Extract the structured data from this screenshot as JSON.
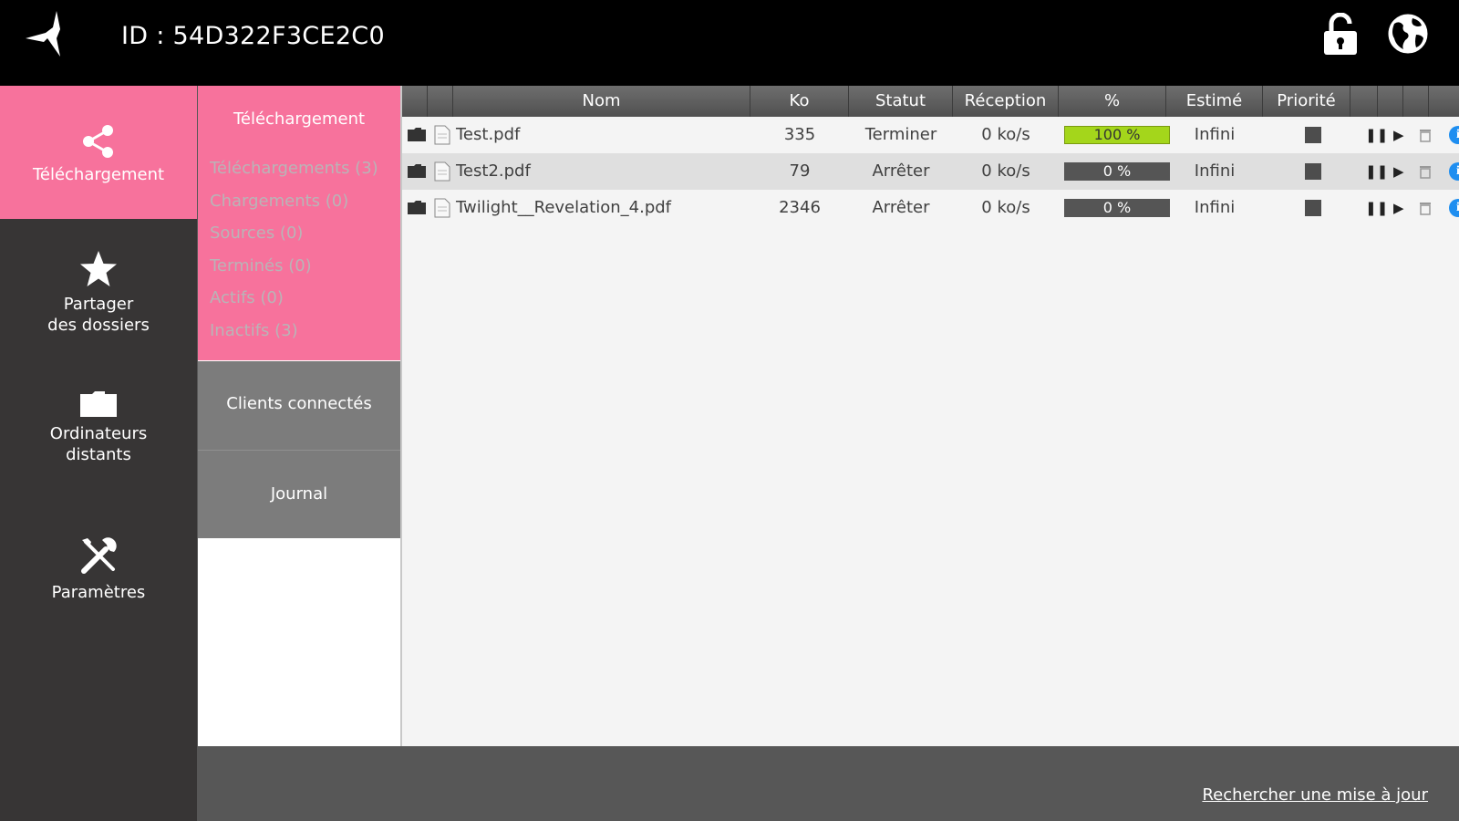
{
  "header": {
    "device_id": "ID : 54D322F3CE2C0",
    "icons": {
      "logo": "bird-logo",
      "lock": "unlocked-padlock-icon",
      "globe": "globe-icon"
    }
  },
  "sidebar": {
    "items": [
      {
        "label": "Téléchargement",
        "icon": "share-icon",
        "active": true
      },
      {
        "label": "Partager\ndes dossiers",
        "icon": "star-icon",
        "active": false
      },
      {
        "label": "Ordinateurs\ndistants",
        "icon": "folder-icon",
        "active": false
      },
      {
        "label": "Paramètres",
        "icon": "tools-icon",
        "active": false
      }
    ]
  },
  "submenu": {
    "title": "Téléchargement",
    "filters": [
      "Téléchargements (3)",
      "Chargements (0)",
      "Sources (0)",
      "Terminés (0)",
      "Actifs (0)",
      "Inactifs (3)"
    ],
    "clients_label": "Clients connectés",
    "journal_label": "Journal"
  },
  "table": {
    "columns": [
      "Nom",
      "Ko",
      "Statut",
      "Réception",
      "%",
      "Estimé",
      "Priorité"
    ],
    "rows": [
      {
        "name": "Test.pdf",
        "size_ko": "335",
        "status": "Terminer",
        "reception": "0 ko/s",
        "percent_label": "100 %",
        "progress": 1.0,
        "estimate": "Infini"
      },
      {
        "name": "Test2.pdf",
        "size_ko": "79",
        "status": "Arrêter",
        "reception": "0 ko/s",
        "percent_label": "0 %",
        "progress": 0.0,
        "estimate": "Infini"
      },
      {
        "name": "Twilight__Revelation_4.pdf",
        "size_ko": "2346",
        "status": "Arrêter",
        "reception": "0 ko/s",
        "percent_label": "0 %",
        "progress": 0.0,
        "estimate": "Infini"
      }
    ]
  },
  "footer": {
    "update_link": "Rechercher une mise à jour"
  },
  "colors": {
    "accent_pink": "#f7729c",
    "progress_green": "#a4d61b",
    "info_blue": "#1e8ef0"
  }
}
